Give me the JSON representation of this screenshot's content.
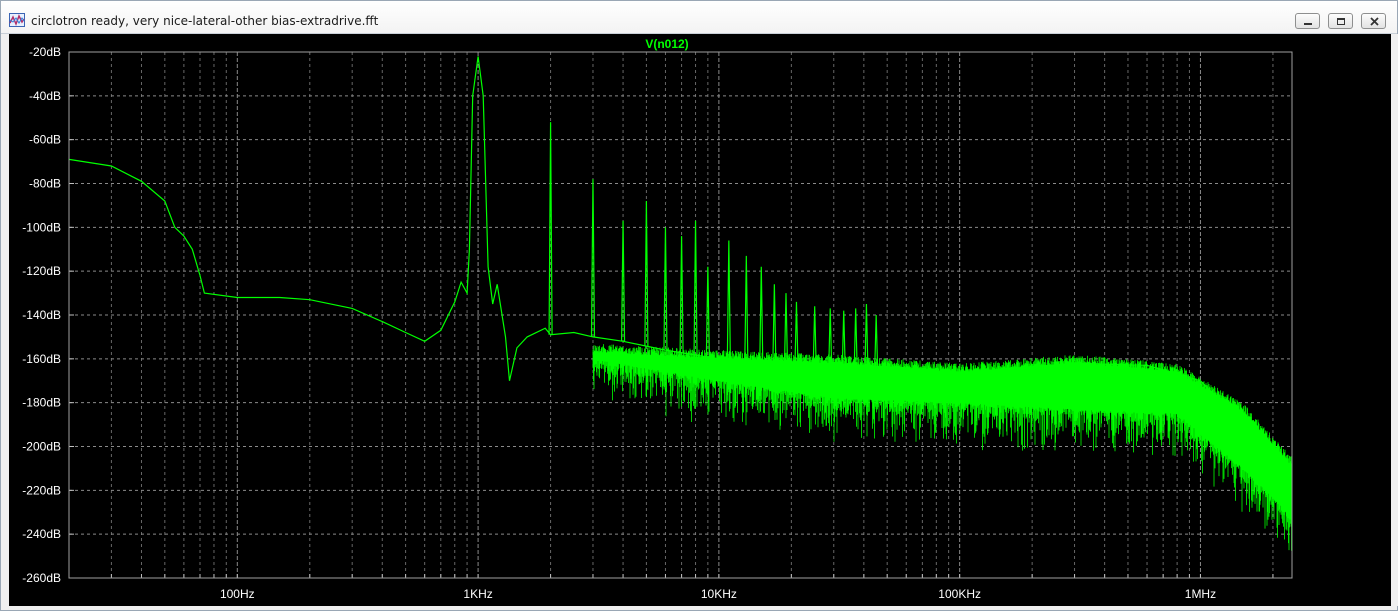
{
  "window": {
    "title": "circlotron ready, very nice-lateral-other bias-extradrive.fft",
    "icons": {
      "app": "waveform-app-icon",
      "minimize": "minimize-icon",
      "maximize": "maximize-icon",
      "close": "close-icon"
    }
  },
  "chart_data": {
    "type": "line",
    "title": "V(n012)",
    "xlabel": "",
    "ylabel": "",
    "x_scale": "log",
    "x_range": [
      20,
      2400000
    ],
    "y_range": [
      -260,
      -20
    ],
    "y_ticks": [
      {
        "value": -20,
        "label": "-20dB"
      },
      {
        "value": -40,
        "label": "-40dB"
      },
      {
        "value": -60,
        "label": "-60dB"
      },
      {
        "value": -80,
        "label": "-80dB"
      },
      {
        "value": -100,
        "label": "-100dB"
      },
      {
        "value": -120,
        "label": "-120dB"
      },
      {
        "value": -140,
        "label": "-140dB"
      },
      {
        "value": -160,
        "label": "-160dB"
      },
      {
        "value": -180,
        "label": "-180dB"
      },
      {
        "value": -200,
        "label": "-200dB"
      },
      {
        "value": -220,
        "label": "-220dB"
      },
      {
        "value": -240,
        "label": "-240dB"
      },
      {
        "value": -260,
        "label": "-260dB"
      }
    ],
    "x_ticks": [
      {
        "value": 100,
        "label": "100Hz"
      },
      {
        "value": 1000,
        "label": "1KHz"
      },
      {
        "value": 10000,
        "label": "10KHz"
      },
      {
        "value": 100000,
        "label": "100KHz"
      },
      {
        "value": 1000000,
        "label": "1MHz"
      }
    ],
    "grid": true,
    "background": "#000000",
    "grid_color": "#8a8a8a",
    "axis_label_color": "#ffffff",
    "series": [
      {
        "name": "V(n012)",
        "color": "#00ff00",
        "baseline": [
          [
            20,
            -69
          ],
          [
            30,
            -72
          ],
          [
            40,
            -79
          ],
          [
            50,
            -88
          ],
          [
            55,
            -100
          ],
          [
            60,
            -104
          ],
          [
            65,
            -110
          ],
          [
            70,
            -122
          ],
          [
            73,
            -130
          ],
          [
            100,
            -132
          ],
          [
            150,
            -132
          ],
          [
            200,
            -133
          ],
          [
            300,
            -137
          ],
          [
            400,
            -143
          ],
          [
            500,
            -148
          ],
          [
            600,
            -152
          ],
          [
            700,
            -147
          ],
          [
            800,
            -134
          ],
          [
            850,
            -125
          ],
          [
            900,
            -130
          ],
          [
            920,
            -110
          ],
          [
            950,
            -40
          ],
          [
            1000,
            -22
          ],
          [
            1050,
            -40
          ],
          [
            1100,
            -118
          ],
          [
            1150,
            -135
          ],
          [
            1200,
            -126
          ],
          [
            1300,
            -150
          ],
          [
            1350,
            -170
          ],
          [
            1450,
            -155
          ],
          [
            1600,
            -150
          ],
          [
            1900,
            -146
          ],
          [
            2000,
            -149
          ],
          [
            2500,
            -148
          ],
          [
            3000,
            -150
          ],
          [
            4000,
            -152
          ],
          [
            6000,
            -156
          ],
          [
            10000,
            -160
          ],
          [
            30000,
            -165
          ],
          [
            100000,
            -167
          ],
          [
            300000,
            -162
          ],
          [
            600000,
            -163
          ],
          [
            1000000,
            -170
          ],
          [
            1500000,
            -190
          ],
          [
            2400000,
            -214
          ]
        ],
        "harmonics": [
          {
            "f": 2000,
            "db": -52
          },
          {
            "f": 3000,
            "db": -78
          },
          {
            "f": 4000,
            "db": -97
          },
          {
            "f": 5000,
            "db": -88
          },
          {
            "f": 6000,
            "db": -100
          },
          {
            "f": 7000,
            "db": -104
          },
          {
            "f": 8000,
            "db": -97
          },
          {
            "f": 9000,
            "db": -118
          },
          {
            "f": 11000,
            "db": -106
          },
          {
            "f": 13000,
            "db": -113
          },
          {
            "f": 15000,
            "db": -118
          },
          {
            "f": 17000,
            "db": -126
          },
          {
            "f": 19000,
            "db": -130
          },
          {
            "f": 21000,
            "db": -134
          },
          {
            "f": 25000,
            "db": -136
          },
          {
            "f": 29000,
            "db": -137
          },
          {
            "f": 33000,
            "db": -138
          },
          {
            "f": 37000,
            "db": -137
          },
          {
            "f": 41000,
            "db": -135
          },
          {
            "f": 45000,
            "db": -140
          }
        ],
        "noise_band": [
          [
            3000,
            -153,
            -160
          ],
          [
            10000,
            -156,
            -170
          ],
          [
            30000,
            -158,
            -178
          ],
          [
            100000,
            -162,
            -180
          ],
          [
            300000,
            -158,
            -183
          ],
          [
            800000,
            -162,
            -185
          ],
          [
            1500000,
            -180,
            -210
          ],
          [
            2400000,
            -205,
            -232
          ]
        ]
      }
    ]
  }
}
